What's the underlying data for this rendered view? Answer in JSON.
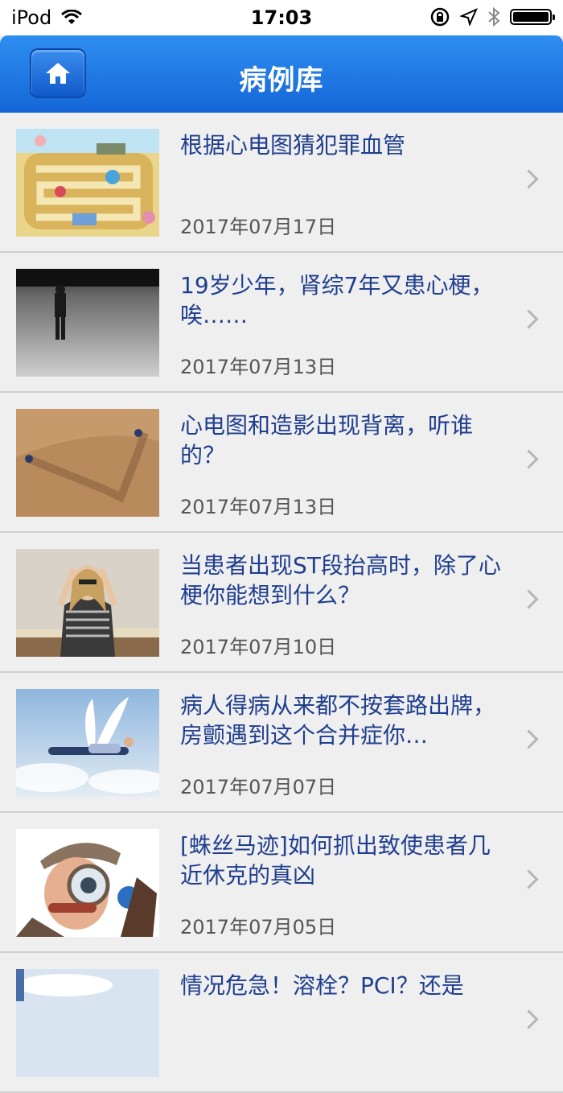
{
  "statusbar": {
    "carrier": "iPod",
    "time": "17:03"
  },
  "navbar": {
    "title": "病例库"
  },
  "colors": {
    "nav_blue": "#1a74e3",
    "title_blue": "#1f3e8e",
    "background": "#efefef"
  },
  "items": [
    {
      "title": "根据心电图猜犯罪血管",
      "date": "2017年07月17日",
      "thumb": "board-game-illustration"
    },
    {
      "title": "19岁少年，肾综7年又患心梗，唉……",
      "date": "2017年07月13日",
      "thumb": "man-in-field-bw"
    },
    {
      "title": "心电图和造影出现背离，听谁的？",
      "date": "2017年07月13日",
      "thumb": "desert-dunes"
    },
    {
      "title": "当患者出现ST段抬高时，除了心梗你能想到什么？",
      "date": "2017年07月10日",
      "thumb": "stressed-woman-books"
    },
    {
      "title": "病人得病从来都不按套路出牌，房颤遇到这个合并症你…",
      "date": "2017年07月07日",
      "thumb": "flying-man-wings"
    },
    {
      "title": "[蛛丝马迹]如何抓出致使患者几近休克的真凶",
      "date": "2017年07月05日",
      "thumb": "detective-magnifier"
    },
    {
      "title": "情况危急！溶栓？PCI？还是",
      "date": "",
      "thumb": "sky"
    }
  ]
}
